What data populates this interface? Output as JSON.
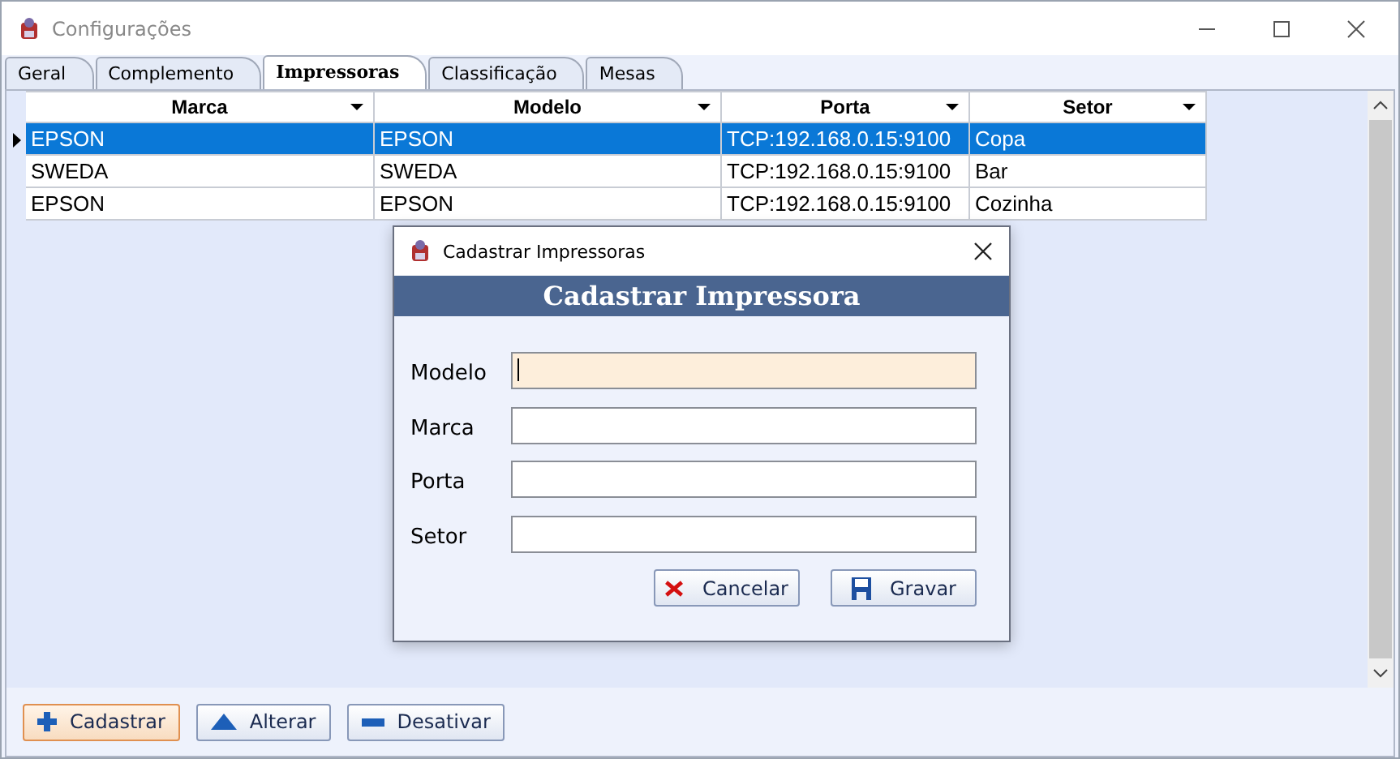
{
  "window": {
    "title": "Configurações"
  },
  "tabs": [
    {
      "label": "Geral",
      "selected": false
    },
    {
      "label": "Complemento",
      "selected": false
    },
    {
      "label": "Impressoras",
      "selected": true
    },
    {
      "label": "Classificação",
      "selected": false
    },
    {
      "label": "Mesas",
      "selected": false
    }
  ],
  "table": {
    "columns": [
      "Marca",
      "Modelo",
      "Porta",
      "Setor"
    ],
    "rows": [
      {
        "cells": [
          "EPSON",
          "EPSON",
          "TCP:192.168.0.15:9100",
          "Copa"
        ],
        "selected": true
      },
      {
        "cells": [
          "SWEDA",
          "SWEDA",
          "TCP:192.168.0.15:9100",
          "Bar"
        ],
        "selected": false
      },
      {
        "cells": [
          "EPSON",
          "EPSON",
          "TCP:192.168.0.15:9100",
          "Cozinha"
        ],
        "selected": false
      }
    ]
  },
  "buttons": [
    {
      "label": "Cadastrar",
      "kind": "add",
      "focused": true
    },
    {
      "label": "Alterar",
      "kind": "edit",
      "focused": false
    },
    {
      "label": "Desativar",
      "kind": "remove",
      "focused": false
    }
  ],
  "dialog": {
    "title": "Cadastrar Impressoras",
    "heading": "Cadastrar Impressora",
    "fields": [
      {
        "label": "Modelo",
        "focused": true
      },
      {
        "label": "Marca",
        "focused": false
      },
      {
        "label": "Porta",
        "focused": false
      },
      {
        "label": "Setor",
        "focused": false
      }
    ],
    "buttons": [
      {
        "label": "Cancelar",
        "kind": "cancel"
      },
      {
        "label": "Gravar",
        "kind": "save"
      }
    ]
  }
}
